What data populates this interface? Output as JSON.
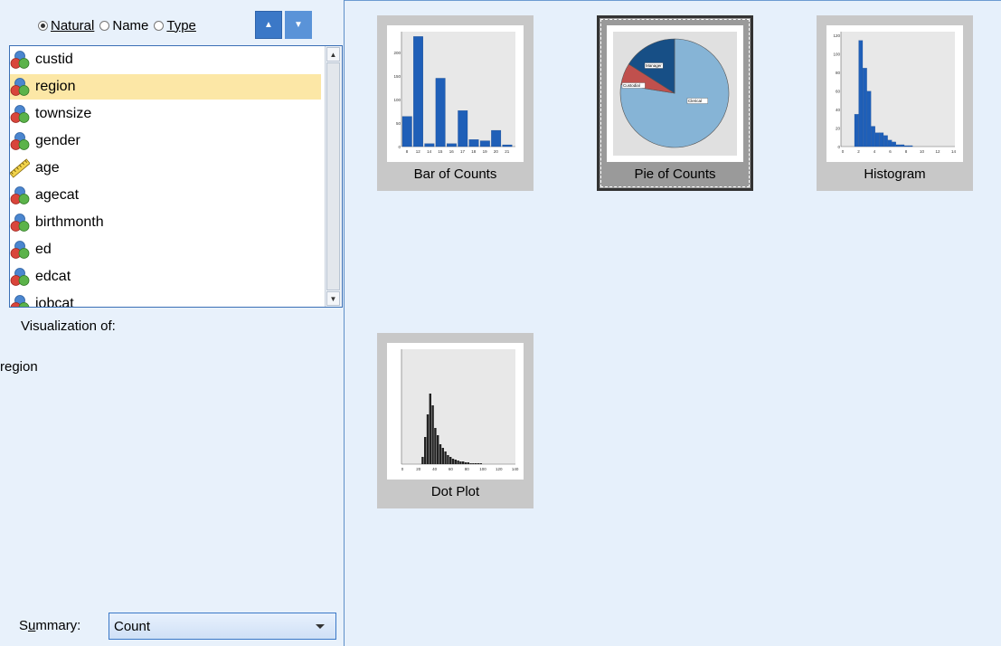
{
  "sort": {
    "options": [
      {
        "label": "Natural",
        "selected": true
      },
      {
        "label": "Name",
        "selected": false
      },
      {
        "label": "Type",
        "selected": false
      }
    ],
    "ascending_icon": "sort-ascending-icon",
    "descending_icon": "sort-descending-icon"
  },
  "variables": [
    {
      "label": "custid",
      "icon": "nominal-icon",
      "selected": false
    },
    {
      "label": "region",
      "icon": "nominal-icon",
      "selected": true
    },
    {
      "label": "townsize",
      "icon": "nominal-icon",
      "selected": false
    },
    {
      "label": "gender",
      "icon": "nominal-icon",
      "selected": false
    },
    {
      "label": "age",
      "icon": "scale-icon",
      "selected": false
    },
    {
      "label": "agecat",
      "icon": "nominal-icon",
      "selected": false
    },
    {
      "label": "birthmonth",
      "icon": "nominal-icon",
      "selected": false
    },
    {
      "label": "ed",
      "icon": "nominal-icon",
      "selected": false
    },
    {
      "label": "edcat",
      "icon": "nominal-icon",
      "selected": false
    },
    {
      "label": "jobcat",
      "icon": "nominal-icon",
      "selected": false
    }
  ],
  "visualization_of_label": "Visualization of:",
  "visualization_of_value": "region",
  "summary": {
    "label": "Summary:",
    "value": "Count"
  },
  "thumbnails": [
    {
      "label": "Bar of Counts",
      "selected": false,
      "x_ticks": [
        "8",
        "12",
        "14",
        "15",
        "16",
        "17",
        "18",
        "19",
        "20",
        "21"
      ],
      "y_ticks": [
        "0",
        "50",
        "100",
        "150",
        "200"
      ]
    },
    {
      "label": "Pie of Counts",
      "selected": true,
      "slice_labels": [
        "Manager",
        "Custodial",
        "Clerical"
      ]
    },
    {
      "label": "Histogram",
      "selected": false,
      "x_ticks": [
        "0",
        "2",
        "4",
        "6",
        "8",
        "10",
        "12",
        "14"
      ],
      "y_ticks": [
        "0",
        "20",
        "40",
        "60",
        "80",
        "100",
        "120"
      ]
    },
    {
      "label": "Dot Plot",
      "selected": false,
      "x_ticks": [
        "0",
        "20",
        "40",
        "60",
        "80",
        "100",
        "120",
        "140"
      ]
    }
  ],
  "colors": {
    "accent": "#3b78c7",
    "selection": "#fce7a6",
    "bar": "#1f5fb8",
    "pie_main": "#86b4d6",
    "pie_dark": "#174f86",
    "pie_red": "#c0504d"
  }
}
